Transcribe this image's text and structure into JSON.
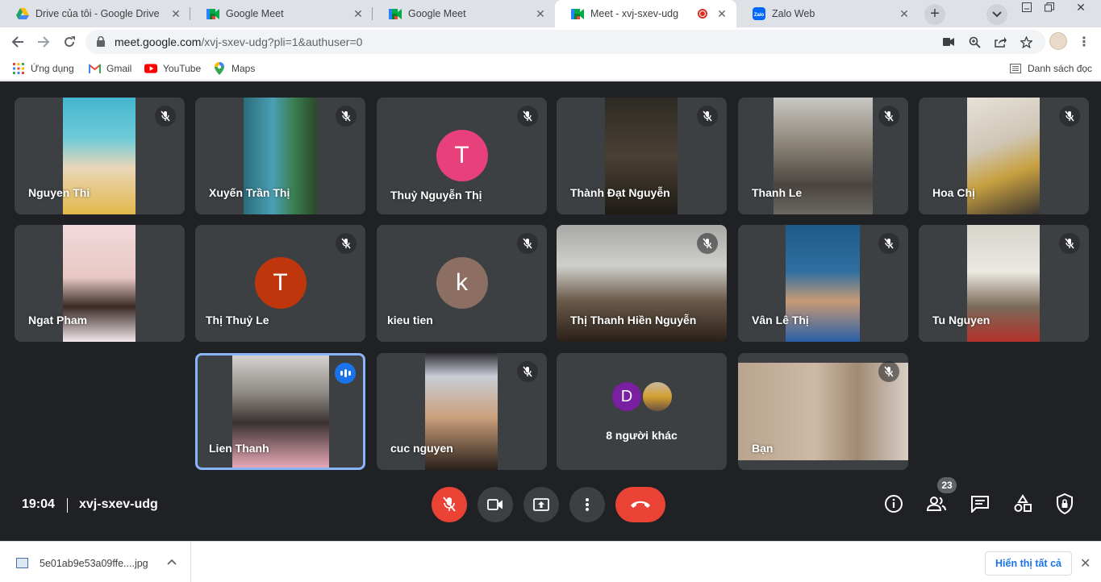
{
  "browser": {
    "tabs": [
      {
        "title": "Drive của tôi - Google Drive",
        "icon": "google-drive-icon"
      },
      {
        "title": "Google Meet",
        "icon": "google-meet-icon"
      },
      {
        "title": "Google Meet",
        "icon": "google-meet-icon"
      },
      {
        "title": "Meet - xvj-sxev-udg",
        "icon": "google-meet-icon",
        "active": true,
        "recording": true
      },
      {
        "title": "Zalo Web",
        "icon": "zalo-icon"
      }
    ],
    "url_host": "meet.google.com",
    "url_path": "/xvj-sxev-udg?pli=1&authuser=0",
    "bookmarks": [
      {
        "label": "Ứng dụng",
        "icon": "apps-grid-icon"
      },
      {
        "label": "Gmail",
        "icon": "gmail-icon"
      },
      {
        "label": "YouTube",
        "icon": "youtube-icon"
      },
      {
        "label": "Maps",
        "icon": "maps-icon"
      }
    ],
    "reading_list": "Danh sách đọc"
  },
  "meet": {
    "tiles": [
      {
        "name": "Nguyen Thi",
        "muted": true
      },
      {
        "name": "Xuyến Trần Thị",
        "muted": true
      },
      {
        "name": "Thuỷ Nguyễn Thị",
        "muted": true,
        "initial": "T",
        "avatar_color": "#e8407a"
      },
      {
        "name": "Thành Đạt Nguyễn",
        "muted": true
      },
      {
        "name": "Thanh Le",
        "muted": true
      },
      {
        "name": "Hoa Chị",
        "muted": true
      },
      {
        "name": "Ngat Pham",
        "muted": false
      },
      {
        "name": "Thị Thuỷ Le",
        "muted": true,
        "initial": "T",
        "avatar_color": "#c0360c"
      },
      {
        "name": "kieu tien",
        "muted": true,
        "initial": "k",
        "avatar_color": "#8d6e63"
      },
      {
        "name": "Thị Thanh Hiền Nguyễn",
        "muted": true
      },
      {
        "name": "Vân Lê Thị",
        "muted": true
      },
      {
        "name": "Tu Nguyen",
        "muted": true
      },
      {
        "name": "Lien Thanh",
        "muted": false,
        "speaking": true
      },
      {
        "name": "cuc nguyen",
        "muted": true
      },
      {
        "others_label": "8 người khác",
        "others_initial": "D",
        "others_color": "#7b1fa2"
      },
      {
        "name": "Bạn",
        "muted": true
      }
    ],
    "time": "19:04",
    "meeting_code": "xvj-sxev-udg",
    "participant_count": "23"
  },
  "downloads": {
    "file_name": "5e01ab9e53a09ffe....jpg",
    "show_all": "Hiển thị tất cả"
  }
}
